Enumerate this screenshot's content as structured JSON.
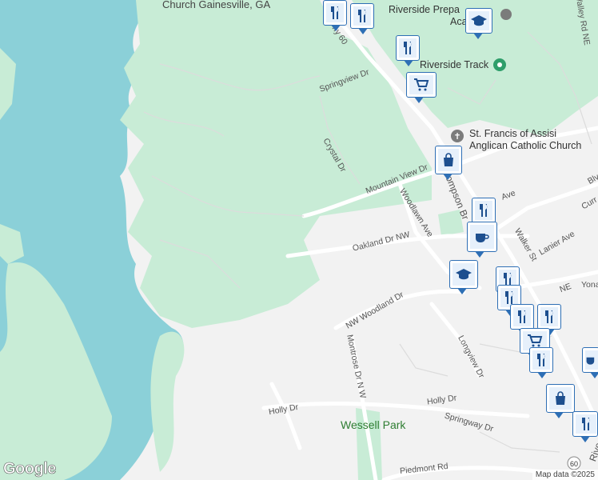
{
  "map": {
    "colors": {
      "water": "#8bd0d8",
      "land": "#f2f2f2",
      "green": "#c8ecd6",
      "road": "#ffffff",
      "road_stroke": "#d6d6d6"
    }
  },
  "labels": {
    "church_gainesville": "Church Gainesville, GA",
    "riverside_prep": "Riverside Prepa",
    "riverside_prep2": "Aca",
    "riverside_track": "Riverside Track",
    "st_francis1": "St. Francis of Assisi",
    "st_francis2": "Anglican Catholic Church",
    "springview": "Springview Dr",
    "crystal": "Crystal Dr",
    "mountain_view": "Mountain View Dr",
    "thompson": "ompson Br",
    "woodlawn": "Woodlawn Ave",
    "oakland": "Oakland Dr NW",
    "walker": "Walker St",
    "lanier": "Lanier Ave",
    "woodland": "NW Woodland Dr",
    "montrose": "Montrose Dr N W",
    "longview": "Longview Dr",
    "holly_dr_left": "Holly Dr",
    "holly_dr_right": "Holly Dr",
    "springway": "Springway Dr",
    "piedmont": "Piedmont Rd",
    "wessell_park": "Wessell Park",
    "valley_rd": "Valley Rd NE",
    "hwy60": "hy 60",
    "ave_label": "Ave",
    "ne_label": "NE",
    "yona": "Yona",
    "bly": "Blv",
    "curr": "Curr",
    "riv": "Rive",
    "shield60": "60"
  },
  "pins": [
    {
      "id": "restaurant-1",
      "type": "restaurant"
    },
    {
      "id": "restaurant-2",
      "type": "restaurant"
    },
    {
      "id": "school-1",
      "type": "school"
    },
    {
      "id": "restaurant-3",
      "type": "restaurant"
    },
    {
      "id": "grocery-1",
      "type": "grocery"
    },
    {
      "id": "shopping-1",
      "type": "shopping"
    },
    {
      "id": "restaurant-4",
      "type": "restaurant"
    },
    {
      "id": "cafe-1",
      "type": "cafe"
    },
    {
      "id": "school-2",
      "type": "school"
    },
    {
      "id": "restaurant-5",
      "type": "restaurant"
    },
    {
      "id": "restaurant-6",
      "type": "restaurant"
    },
    {
      "id": "restaurant-7",
      "type": "restaurant"
    },
    {
      "id": "grocery-2",
      "type": "grocery"
    },
    {
      "id": "restaurant-8",
      "type": "restaurant"
    },
    {
      "id": "cafe-2",
      "type": "cafe"
    },
    {
      "id": "shopping-2",
      "type": "shopping"
    },
    {
      "id": "restaurant-9",
      "type": "restaurant"
    }
  ],
  "footer": {
    "logo": "Google",
    "attribution": "Map data ©2025"
  }
}
